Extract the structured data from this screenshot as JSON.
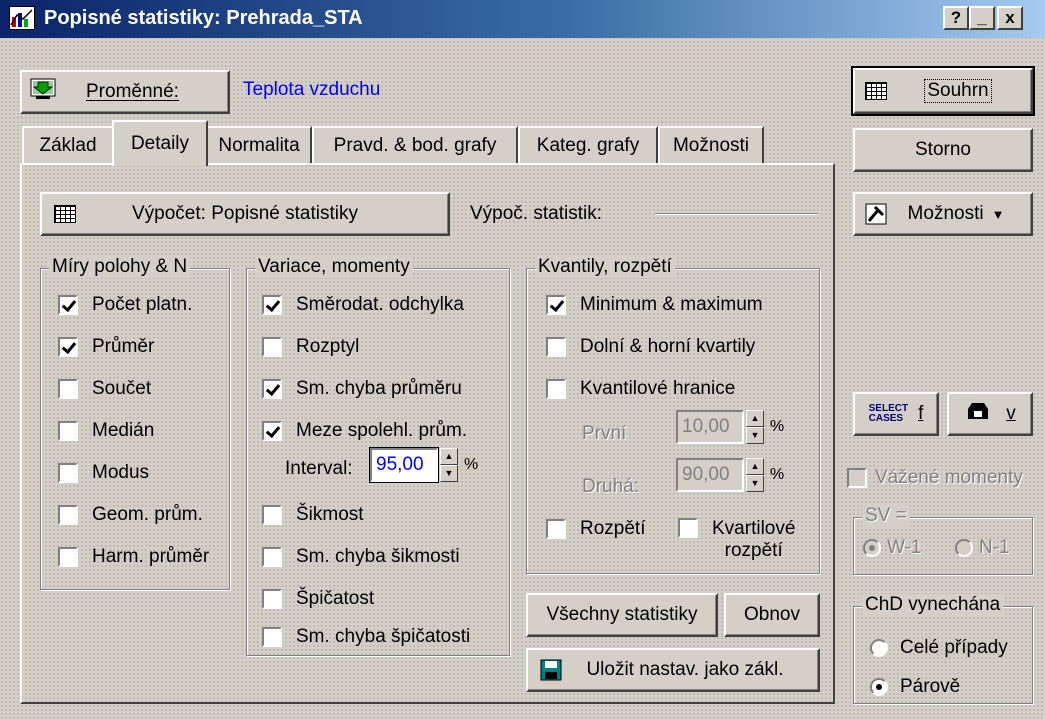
{
  "window": {
    "title": "Popisné statistiky: Prehrada_STA",
    "caption_buttons": [
      "?",
      "_",
      "x"
    ]
  },
  "variables": {
    "button_label": "Proměnné:",
    "value": "Teplota vzduchu"
  },
  "tabs": [
    "Základ",
    "Detaily",
    "Normalita",
    "Pravd. & bod. grafy",
    "Kateg. grafy",
    "Možnosti"
  ],
  "active_tab": "Detaily",
  "compute": {
    "button_label": "Výpočet: Popisné statistiky",
    "stat_label": "Výpoč. statistik:"
  },
  "groups": {
    "location": {
      "title": "Míry polohy & N",
      "items": [
        {
          "label": "Počet platn.",
          "checked": true
        },
        {
          "label": "Průměr",
          "checked": true
        },
        {
          "label": "Součet",
          "checked": false
        },
        {
          "label": "Medián",
          "checked": false
        },
        {
          "label": "Modus",
          "checked": false
        },
        {
          "label": "Geom. prům.",
          "checked": false
        },
        {
          "label": "Harm. průměr",
          "checked": false
        }
      ]
    },
    "variation": {
      "title": "Variace, momenty",
      "items": [
        {
          "label": "Směrodat. odchylka",
          "checked": true
        },
        {
          "label": "Rozptyl",
          "checked": false
        },
        {
          "label": "Sm. chyba průměru",
          "checked": true
        },
        {
          "label": "Meze spolehl. prům.",
          "checked": true
        },
        {
          "label": "Šikmost",
          "checked": false
        },
        {
          "label": "Sm. chyba šikmosti",
          "checked": false
        },
        {
          "label": "Špičatost",
          "checked": false
        },
        {
          "label": "Sm. chyba špičatosti",
          "checked": false
        }
      ],
      "interval_label": "Interval:",
      "interval_value": "95,00",
      "percent": "%"
    },
    "quantiles": {
      "title": "Kvantily, rozpětí",
      "items": [
        {
          "label": "Minimum & maximum",
          "checked": true
        },
        {
          "label": "Dolní & horní kvartily",
          "checked": false
        },
        {
          "label": "Kvantilové hranice",
          "checked": false
        }
      ],
      "first_label": "První",
      "first_value": "10,00",
      "second_label": "Druhá:",
      "second_value": "90,00",
      "percent": "%",
      "range_label": "Rozpětí",
      "range_checked": false,
      "iqr_label_1": "Kvartilové",
      "iqr_label_2": "rozpětí",
      "iqr_checked": false
    }
  },
  "bottom_buttons": {
    "all_stats": "Všechny statistiky",
    "reset": "Obnov",
    "save_defaults": "Uložit nastav. jako zákl."
  },
  "right_panel": {
    "summary": "Souhrn",
    "cancel": "Storno",
    "options": "Možnosti",
    "select_cases_icon_1": "SELECT",
    "select_cases_icon_2": "CASES",
    "select_cases_letter": "f",
    "weight_letter": "v",
    "weighted_moments": "Vážené momenty",
    "sv_title": "SV =",
    "sv_options": [
      "W-1",
      "N-1"
    ],
    "sv_selected": "W-1",
    "md_title": "ChD vynechána",
    "md_options": [
      "Celé případy",
      "Párově"
    ],
    "md_selected": "Párově"
  },
  "icons": {
    "app": "chart-icon",
    "variables": "variables-arrow-icon",
    "summary": "summary-grid-icon",
    "options": "options-icon",
    "save": "floppy-disk-icon",
    "weight": "weight-icon"
  }
}
